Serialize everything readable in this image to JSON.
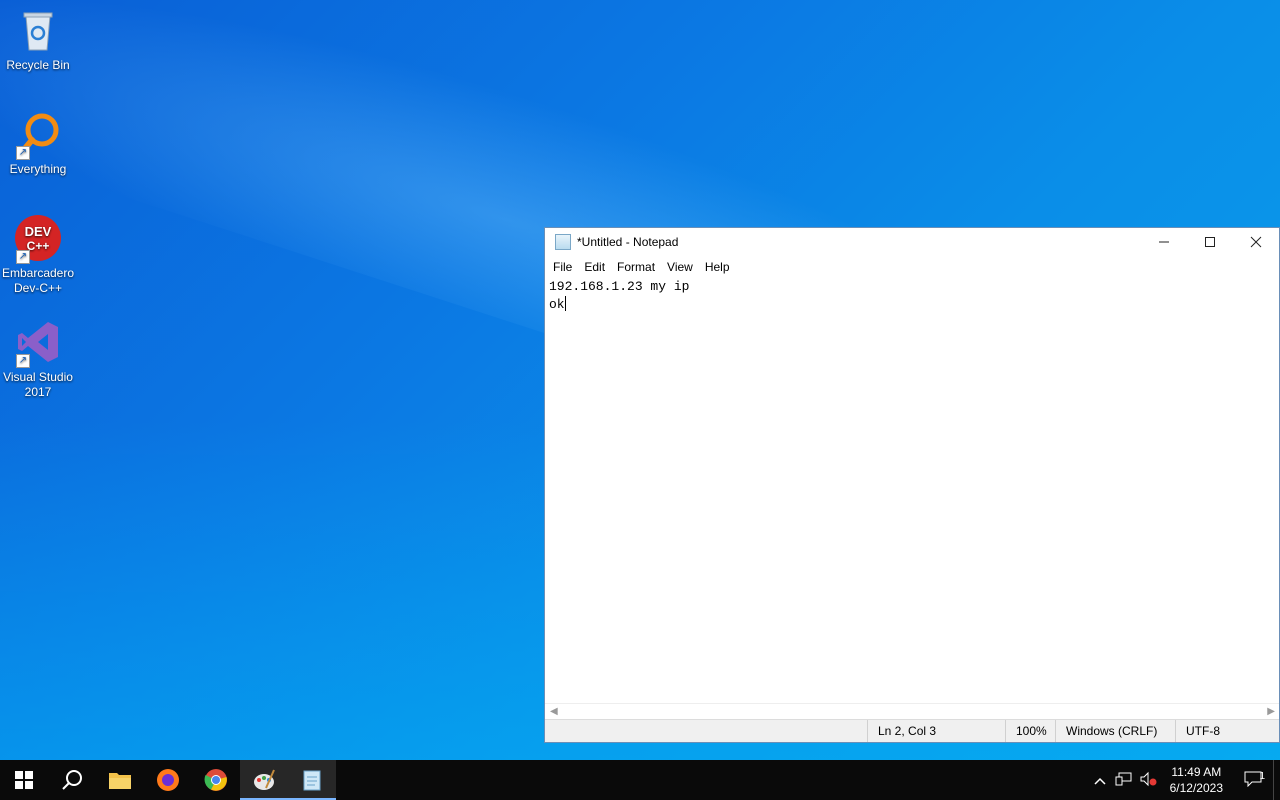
{
  "desktop": {
    "icons": [
      {
        "label_line1": "Recycle Bin",
        "label_line2": "",
        "icon": "recycle-bin-icon"
      },
      {
        "label_line1": "Everything",
        "label_line2": "",
        "icon": "everything-search-icon"
      },
      {
        "label_line1": "Embarcadero",
        "label_line2": "Dev-C++",
        "icon": "dev-cpp-icon",
        "badge": "DEV C++"
      },
      {
        "label_line1": "Visual Studio",
        "label_line2": "2017",
        "icon": "visual-studio-icon"
      }
    ]
  },
  "notepad": {
    "title": "*Untitled - Notepad",
    "window_controls": {
      "minimize": "—",
      "maximize": "☐",
      "close": "✕"
    },
    "menu": [
      "File",
      "Edit",
      "Format",
      "View",
      "Help"
    ],
    "content_lines": [
      "192.168.1.23 my ip",
      "ok"
    ],
    "status": {
      "position": "Ln 2, Col 3",
      "zoom": "100%",
      "line_ending": "Windows (CRLF)",
      "encoding": "UTF-8"
    }
  },
  "taskbar": {
    "apps": [
      "start-icon",
      "search-icon",
      "file-explorer-icon",
      "firefox-icon",
      "chrome-icon",
      "paint-icon",
      "notepad-icon"
    ],
    "tray": {
      "time": "11:49 AM",
      "date": "6/12/2023",
      "notification_count": "1"
    }
  },
  "colors": {
    "taskbar": "#0a0a0a",
    "accent": "#7ab6ff",
    "desktop": "#0b78e3"
  }
}
